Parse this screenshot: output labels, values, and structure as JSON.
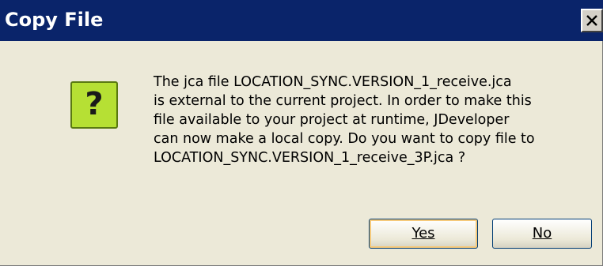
{
  "dialog": {
    "title": "Copy File",
    "close_icon": "close-icon",
    "icon": "question-icon",
    "icon_glyph": "?",
    "message_lines": [
      "The jca file LOCATION_SYNC.VERSION_1_receive.jca",
      "is external to the current project. In order to make this",
      "file available to your project at runtime, JDeveloper",
      "can now make a local copy. Do you want to copy file to",
      "LOCATION_SYNC.VERSION_1_receive_3P.jca ?"
    ],
    "buttons": {
      "yes_label": "Yes",
      "no_label": "No"
    }
  },
  "colors": {
    "titlebar": "#0a246a",
    "dialog_bg": "#ece9d8",
    "icon_bg": "#b6e034",
    "default_button_highlight": "#f5c97a"
  }
}
